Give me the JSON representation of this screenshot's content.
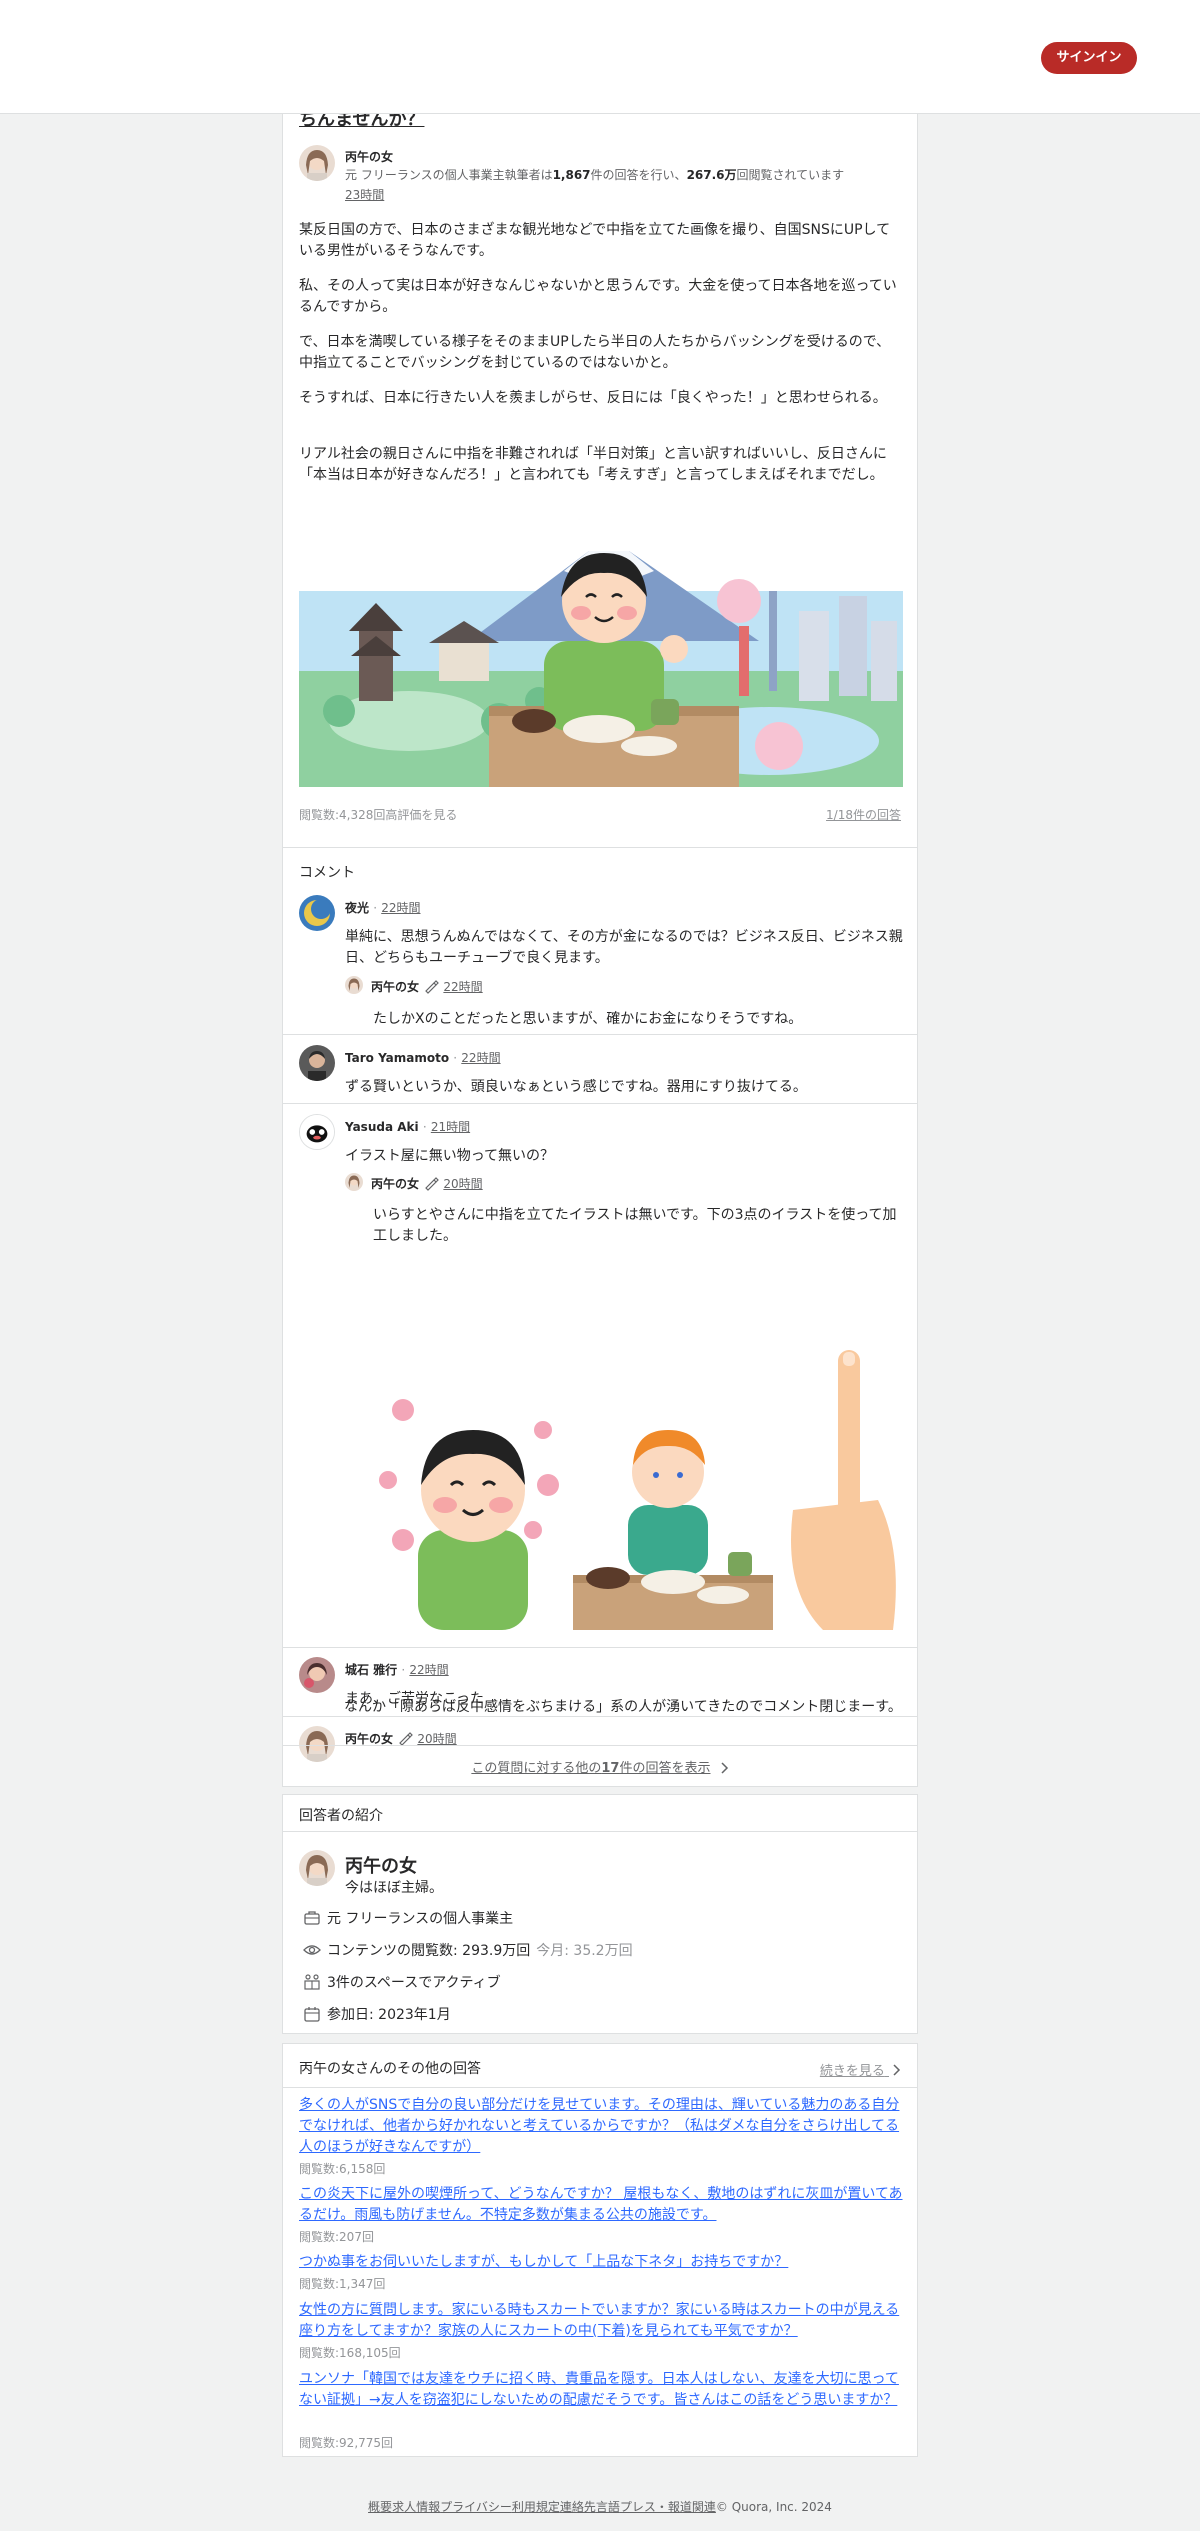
{
  "header": {
    "signin_label": "サインイン"
  },
  "question": {
    "title_fragment": "ちんませんか？"
  },
  "answer": {
    "author_name": "丙午の女",
    "credential_prefix": "元 フリーランスの個人事業主執筆者は",
    "answers_count": "1,867",
    "credential_mid": "件の回答を行い、",
    "views_count": "267.6万",
    "credential_suffix": "回閲覧されています",
    "time": "23時間",
    "paragraphs": [
      "某反日国の方で、日本のさまざまな観光地などで中指を立てた画像を撮り、自国SNSにUPしている男性がいるそうなんです。",
      "私、その人って実は日本が好きなんじゃないかと思うんです。大金を使って日本各地を巡っているんですから。",
      "で、日本を満喫している様子をそのままUPしたら半日の人たちからバッシングを受けるので、中指立てることでバッシングを封じているのではないかと。",
      "そうすれば、日本に行きたい人を羨ましがらせ、反日には「良くやった！」と思わせられる。",
      "リアル社会の親日さんに中指を非難されれば「半日対策」と言い訳すればいいし、反日さんに「本当は日本が好きなんだろ！」と言われても「考えすぎ」と言ってしまえばそれまでだし。"
    ],
    "stats": "閲覧数:4,328回高評価を見る",
    "position": "1/18件の回答"
  },
  "comments": {
    "heading": "コメント",
    "items": [
      {
        "name": "夜光",
        "time": "22時間",
        "text": "単純に、思想うんぬんではなくて、その方が金になるのでは？ビジネス反日、ビジネス親日、どちらもユーチューブで良く見ます。"
      },
      {
        "name": "丙午の女",
        "time": "22時間",
        "text": "たしかXのことだったと思いますが、確かにお金になりそうですね。"
      },
      {
        "name": "Taro Yamamoto",
        "time": "22時間",
        "text": "ずる賢いというか、頭良いなぁという感じですね。器用にすり抜けてる。"
      },
      {
        "name": "Yasuda Aki",
        "time": "21時間",
        "text": "イラスト屋に無い物って無いの？"
      },
      {
        "name": "丙午の女",
        "time": "20時間",
        "text": "いらすとやさんに中指を立てたイラストは無いです。下の3点のイラストを使って加工しました。"
      },
      {
        "name": "城石 雅行",
        "time": "22時間",
        "text": "まあ、ご苦労なこった"
      },
      {
        "name": "丙午の女",
        "time": "20時間",
        "text": "なんか「隙あらば反中感情をぶちまける」系の人が湧いてきたのでコメント閉じまーす。"
      }
    ],
    "dot": "·"
  },
  "more_answers": {
    "prefix": "この質問に対する他の",
    "count": "17",
    "suffix": "件の回答を表示"
  },
  "profile": {
    "heading": "回答者の紹介",
    "name": "丙午の女",
    "bio": "今はほぼ主婦。",
    "work": "元 フリーランスの個人事業主",
    "views_label": "コンテンツの閲覧数: 293.9万回",
    "views_month": "今月: 35.2万回",
    "spaces": "3件のスペースでアクティブ",
    "joined": "参加日: 2023年1月"
  },
  "other_answers": {
    "heading": "丙午の女さんのその他の回答",
    "see_all": "続きを見る",
    "items": [
      {
        "q": "多くの人がSNSで自分の良い部分だけを見せています。その理由は、輝いている魅力のある自分でなければ、他者から好かれないと考えているからですか？（私はダメな自分をさらけ出してる人のほうが好きなんですが）",
        "v": "閲覧数:6,158回"
      },
      {
        "q": "この炎天下に屋外の喫煙所って、どうなんですか？ 屋根もなく、敷地のはずれに灰皿が置いてあるだけ。雨風も防げません。不特定多数が集まる公共の施設です。",
        "v": "閲覧数:207回"
      },
      {
        "q": "つかぬ事をお伺いいたしますが、もしかして「上品な下ネタ」お持ちですか？",
        "v": "閲覧数:1,347回"
      },
      {
        "q": "女性の方に質問します。家にいる時もスカートでいますか？家にいる時はスカートの中が見える座り方をしてますか？家族の人にスカートの中(下着)を見られても平気ですか？",
        "v": "閲覧数:168,105回"
      },
      {
        "q": "ユンソナ「韓国では友達をウチに招く時、貴重品を隠す。日本人はしない、友達を大切に思ってない証拠」→友人を窃盗犯にしないための配慮だそうです。皆さんはこの話をどう思いますか？",
        "v": "閲覧数:92,775回"
      }
    ]
  },
  "footer": {
    "links": [
      "概要",
      "求人情報",
      "プライバシー",
      "利用規定",
      "連絡先",
      "言語",
      "プレス・報道関連"
    ],
    "copyright": "© Quora, Inc. 2024"
  },
  "colors": {
    "accent": "#b92b27",
    "link": "#2e69ff",
    "text": "#282829",
    "muted": "#939598"
  }
}
